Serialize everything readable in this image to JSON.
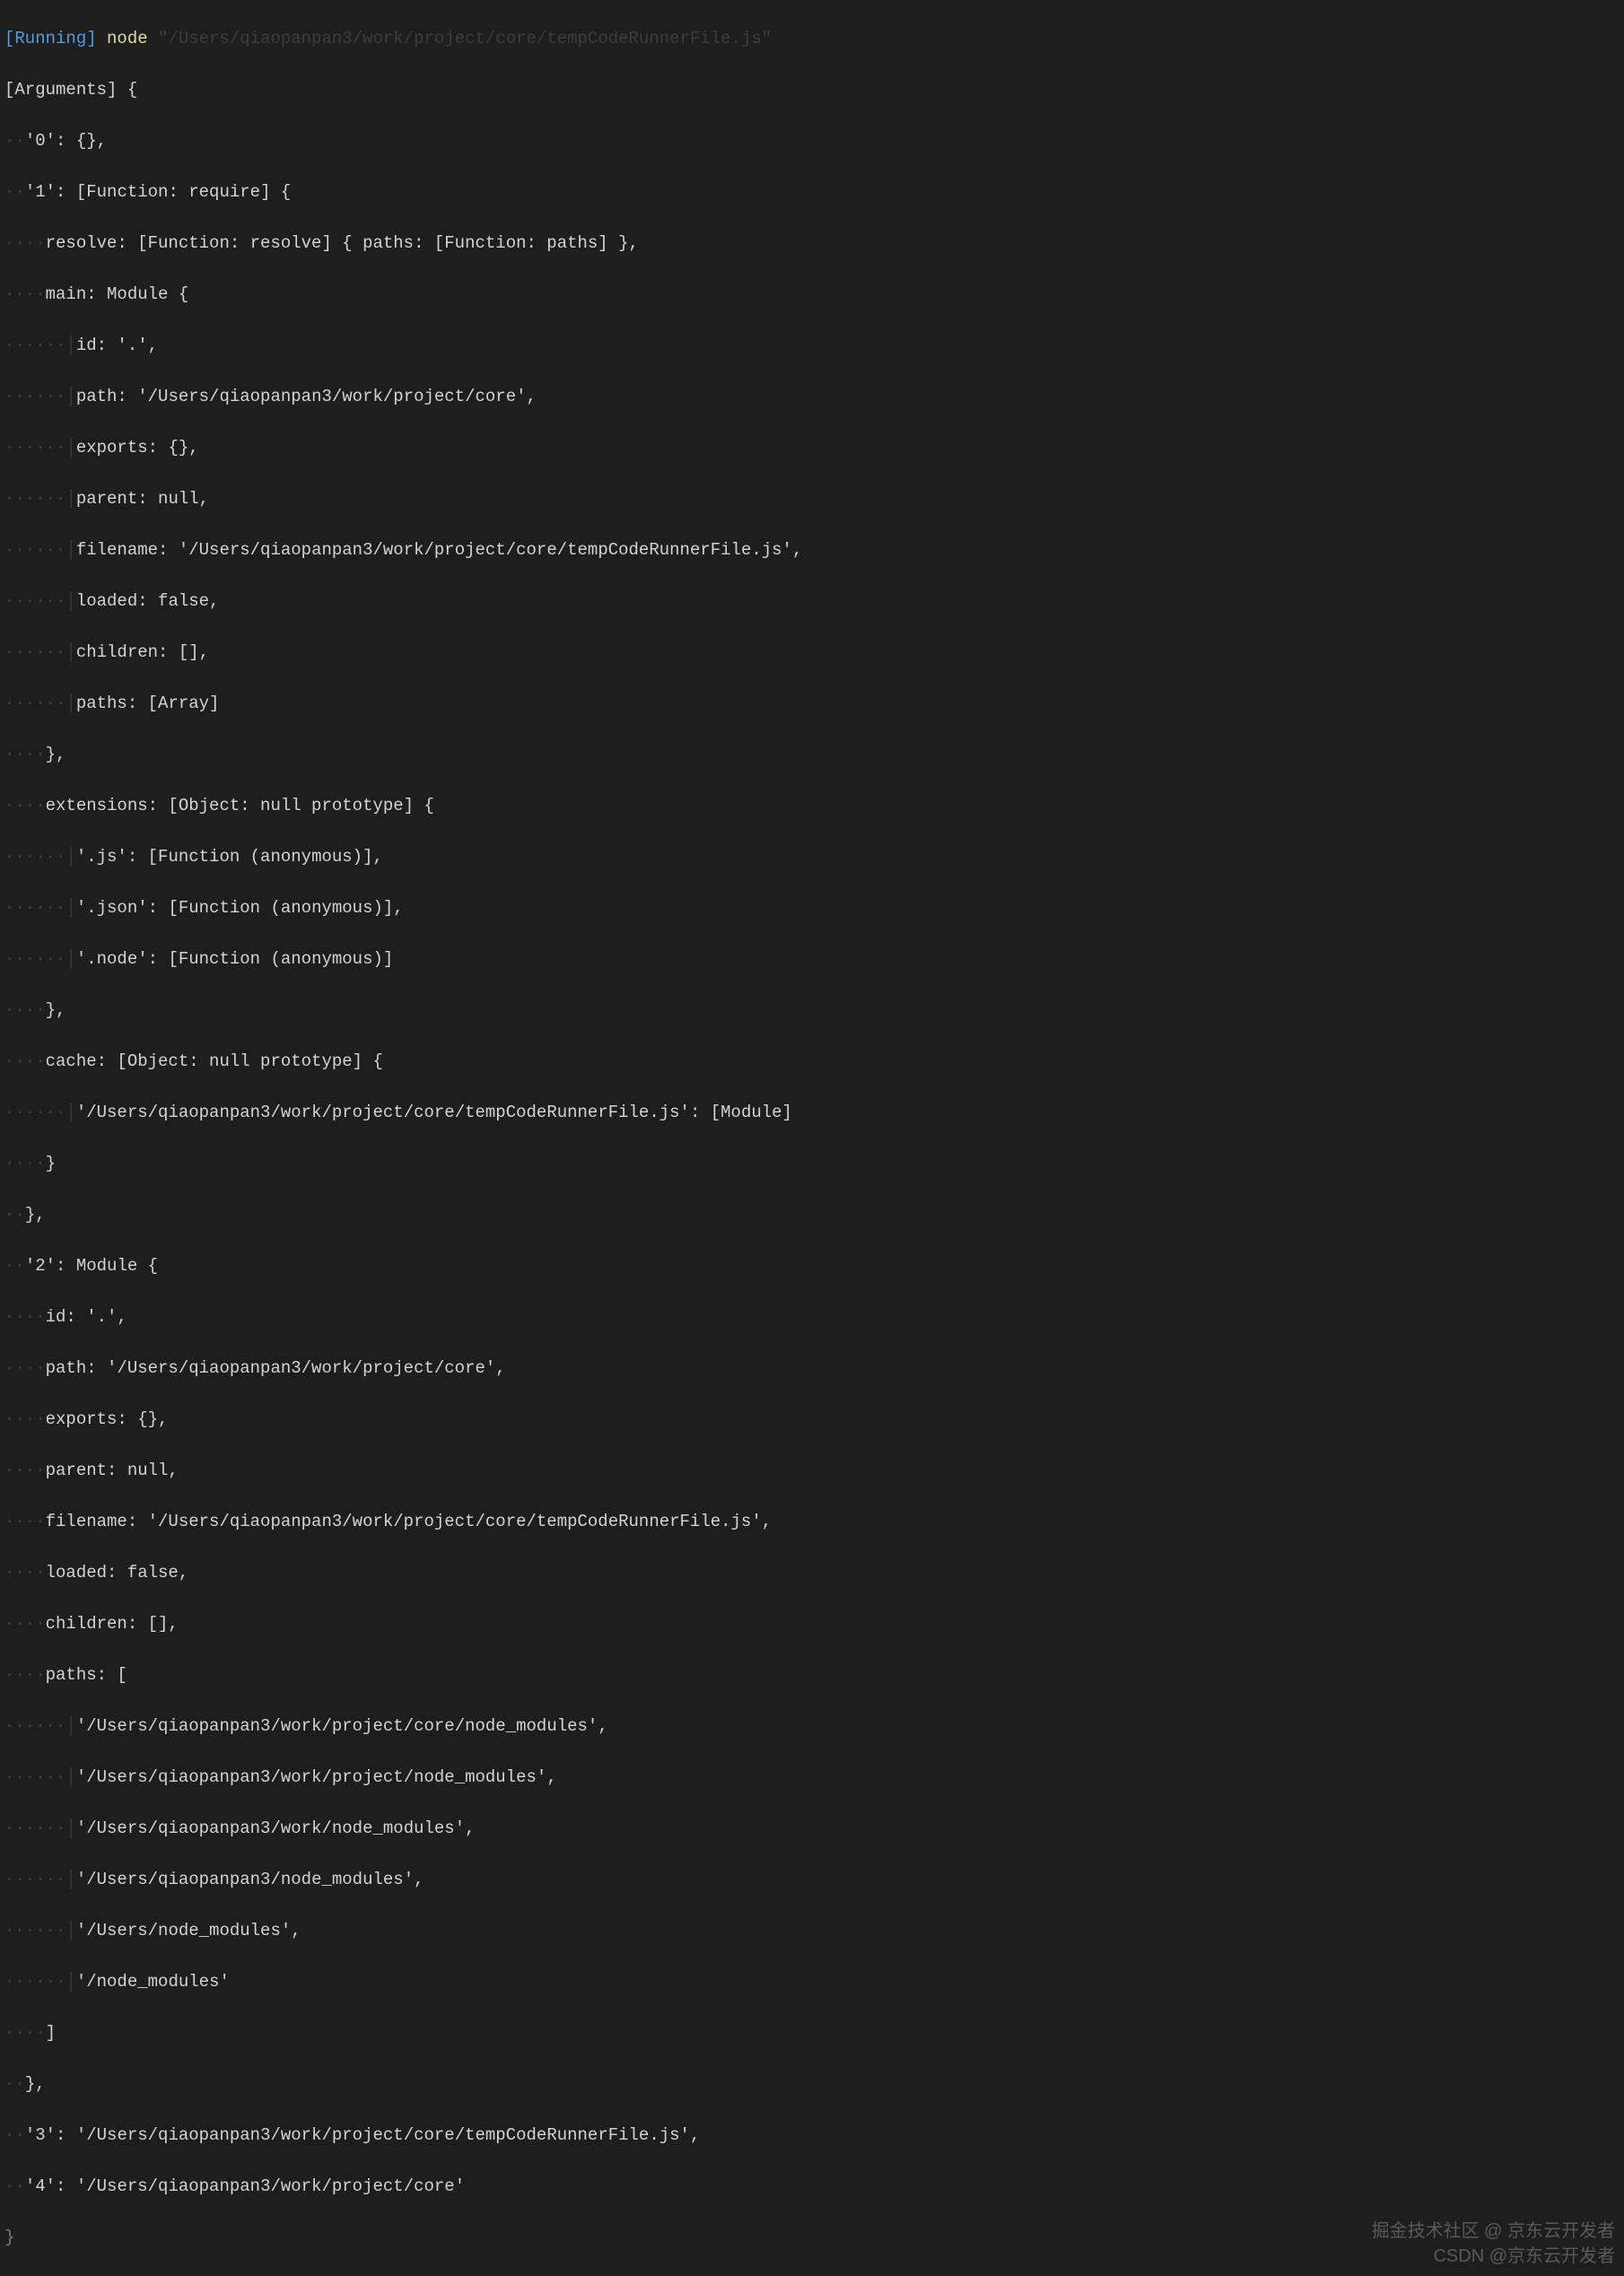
{
  "header": {
    "running_prefix": "[Running]",
    "node_cmd": "node",
    "truncated_path": "\"/Users/qiaopanpan3/work/project/core/tempCodeRunnerFile.js\""
  },
  "code": {
    "l0": "[Arguments] {",
    "l1_key": "'0'",
    "l1_val": ": {},",
    "l2_key": "'1'",
    "l2_val": ": [Function: require] {",
    "l3": "resolve: [Function: resolve] { paths: [Function: paths] },",
    "l4": "main: Module {",
    "l5": "id: '.',",
    "l6": "path: '/Users/qiaopanpan3/work/project/core',",
    "l7": "exports: {},",
    "l8": "parent: null,",
    "l9": "filename: '/Users/qiaopanpan3/work/project/core/tempCodeRunnerFile.js',",
    "l10": "loaded: false,",
    "l11": "children: [],",
    "l12": "paths: [Array]",
    "l13": "},",
    "l14": "extensions: [Object: null prototype] {",
    "l15": "'.js': [Function (anonymous)],",
    "l16": "'.json': [Function (anonymous)],",
    "l17": "'.node': [Function (anonymous)]",
    "l18": "},",
    "l19": "cache: [Object: null prototype] {",
    "l20": "'/Users/qiaopanpan3/work/project/core/tempCodeRunnerFile.js': [Module]",
    "l21": "}",
    "l22": "},",
    "l23_key": "'2'",
    "l23_val": ": Module {",
    "l24": "id: '.',",
    "l25": "path: '/Users/qiaopanpan3/work/project/core',",
    "l26": "exports: {},",
    "l27": "parent: null,",
    "l28": "filename: '/Users/qiaopanpan3/work/project/core/tempCodeRunnerFile.js',",
    "l29": "loaded: false,",
    "l30": "children: [],",
    "l31": "paths: [",
    "l32": "'/Users/qiaopanpan3/work/project/core/node_modules',",
    "l33": "'/Users/qiaopanpan3/work/project/node_modules',",
    "l34": "'/Users/qiaopanpan3/work/node_modules',",
    "l35": "'/Users/qiaopanpan3/node_modules',",
    "l36": "'/Users/node_modules',",
    "l37": "'/node_modules'",
    "l38": "]",
    "l39": "},",
    "l40_key": "'3'",
    "l40_val": ": '/Users/qiaopanpan3/work/project/core/tempCodeRunnerFile.js',",
    "l41_key": "'4'",
    "l41_val": ": '/Users/qiaopanpan3/work/project/core'",
    "l42": "}"
  },
  "guides": {
    "d1": "·",
    "d2": "··",
    "d3": "···",
    "d4": "····",
    "p1": "│",
    "p2": "··│",
    "p3": "····│"
  },
  "watermark": {
    "line1": "掘金技术社区 @ 京东云开发者",
    "line2": "CSDN @京东云开发者"
  }
}
